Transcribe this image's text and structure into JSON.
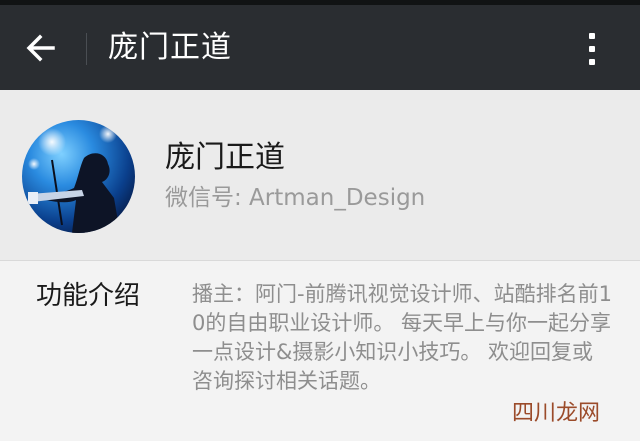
{
  "toolbar": {
    "back_icon": "arrow-left-icon",
    "title": "庞门正道",
    "more_icon": "more-vertical-icon"
  },
  "profile": {
    "name": "庞门正道",
    "wechat_id": "微信号: Artman_Design"
  },
  "intro": {
    "label": "功能介绍",
    "text": "播主：阿门-前腾讯视觉设计师、站酷排名前10的自由职业设计师。 每天早上与你一起分享一点设计&摄影小知识小技巧。 欢迎回复或咨询探讨相关话题。"
  },
  "watermark": "四川龙网",
  "colors": {
    "toolbar_bg": "#2a2d31",
    "profile_bg": "#ebebeb",
    "page_bg": "#f3f3f3",
    "secondary_text": "#9a9a9a"
  }
}
